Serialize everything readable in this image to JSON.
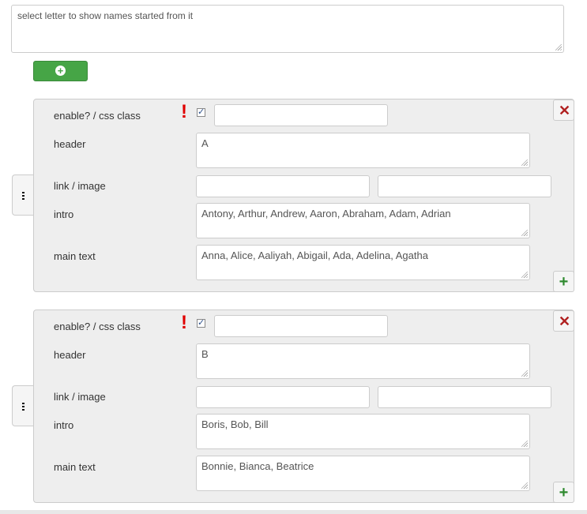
{
  "top_description": "select letter to show names started from it",
  "labels": {
    "enable_css": "enable? / css class",
    "header": "header",
    "link_image": "link / image",
    "intro": "intro",
    "main_text": "main text"
  },
  "icons": {
    "add_top": "plus-circle-icon",
    "warning": "exclamation-icon",
    "close": "close-icon",
    "add": "plus-icon",
    "handle": "drag-handle-icon"
  },
  "colors": {
    "green_button": "#46a546",
    "warning_red": "#e00000",
    "close_red": "#b02020",
    "plus_green": "#2f8a2f"
  },
  "items": [
    {
      "enabled": true,
      "css_class": "",
      "header": "A",
      "link": "",
      "image": "",
      "intro": "Antony, Arthur, Andrew, Aaron, Abraham, Adam, Adrian",
      "main_text": "Anna, Alice, Aaliyah, Abigail, Ada, Adelina, Agatha"
    },
    {
      "enabled": true,
      "css_class": "",
      "header": "B",
      "link": "",
      "image": "",
      "intro": "Boris, Bob, Bill",
      "main_text": "Bonnie, Bianca, Beatrice"
    }
  ]
}
